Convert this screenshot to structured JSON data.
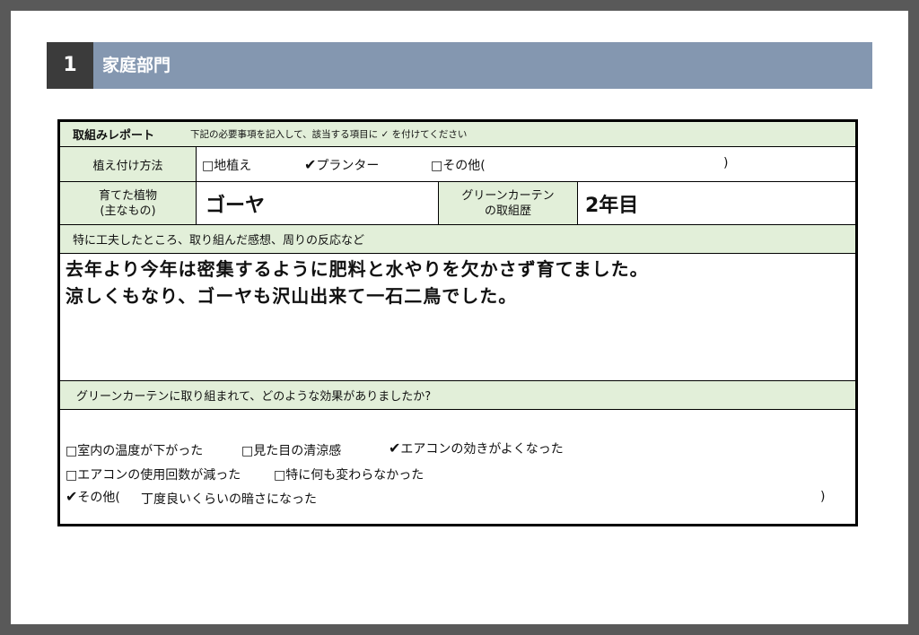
{
  "section": {
    "number": "1",
    "title": "家庭部門"
  },
  "report": {
    "title": "取組みレポート",
    "instructions": "下記の必要事項を記入して、該当する項目に ✓ を付けてください"
  },
  "planting": {
    "label": "植え付け方法",
    "options": [
      {
        "mark": "□",
        "text": "地植え"
      },
      {
        "mark": "✔",
        "text": "プランター"
      },
      {
        "mark": "□",
        "text": "その他("
      }
    ],
    "close_paren": ")"
  },
  "plant": {
    "label_line1": "育てた植物",
    "label_line2": "(主なもの)",
    "value": "ゴーヤ",
    "history_label_line1": "グリーンカーテン",
    "history_label_line2": "の取組歴",
    "history_value": "2年目"
  },
  "comments": {
    "label": "特に工夫したところ、取り組んだ感想、周りの反応など",
    "line1": "去年より今年は密集するように肥料と水やりを欠かさず育てました。",
    "line2": "涼しくもなり、ゴーヤも沢山出来て一石二鳥でした。"
  },
  "effects": {
    "label": "グリーンカーテンに取り組まれて、どのような効果がありましたか?",
    "items": [
      {
        "mark": "□",
        "text": "室内の温度が下がった"
      },
      {
        "mark": "□",
        "text": "見た目の清涼感"
      },
      {
        "mark": "✔",
        "text": "エアコンの効きがよくなった"
      },
      {
        "mark": "□",
        "text": "エアコンの使用回数が減った"
      },
      {
        "mark": "□",
        "text": "特に何も変わらなかった"
      },
      {
        "mark": "✔",
        "text": "その他("
      }
    ],
    "other_value": "丁度良いくらいの暗さになった",
    "close_paren": ")"
  }
}
